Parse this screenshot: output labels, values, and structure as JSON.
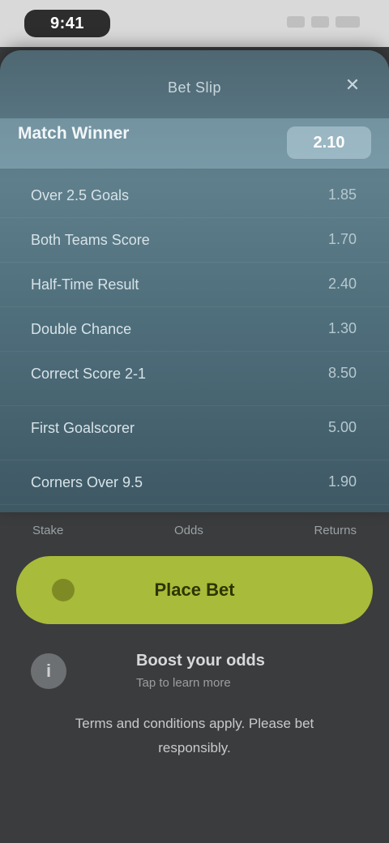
{
  "status_bar": {
    "time": "9:41"
  },
  "header": {
    "title": "Bet Slip",
    "close_label": "✕"
  },
  "selected": {
    "name": "Match Winner",
    "odds": "2.10"
  },
  "selections": [
    {
      "name": "Over 2.5 Goals",
      "odds": "1.85"
    },
    {
      "name": "Both Teams Score",
      "odds": "1.70"
    },
    {
      "name": "Half-Time Result",
      "odds": "2.40"
    },
    {
      "name": "Double Chance",
      "odds": "1.30"
    },
    {
      "name": "Correct Score 2-1",
      "odds": "8.50"
    },
    {
      "name": "First Goalscorer",
      "odds": "5.00"
    },
    {
      "name": "Corners Over 9.5",
      "odds": "1.90"
    }
  ],
  "summary": {
    "left": "Stake",
    "middle": "Odds",
    "right": "Returns"
  },
  "cta": {
    "label": "Place Bet"
  },
  "promo": {
    "icon": "info-icon",
    "title": "Boost your odds",
    "subtitle": "Tap to learn more"
  },
  "footer": {
    "text": "Terms and conditions apply. Please bet responsibly."
  }
}
